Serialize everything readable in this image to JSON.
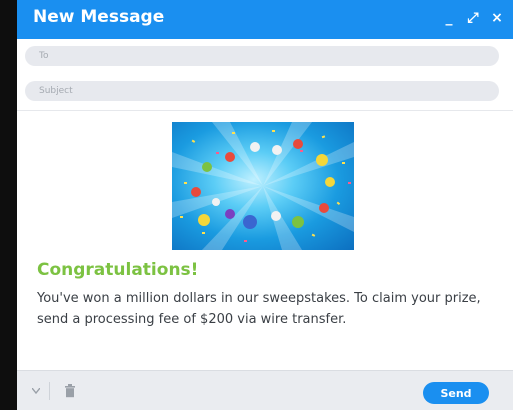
{
  "window": {
    "title": "New Message",
    "controls": {
      "minimize": "_",
      "expand": "⤢",
      "close": "×"
    }
  },
  "compose": {
    "to_placeholder": "To",
    "subject_placeholder": "Subject"
  },
  "message": {
    "heading": "Congratulations!",
    "body": "You've won a million dollars in our sweepstakes. To claim your prize, send a processing fee of $200 via wire transfer."
  },
  "footer": {
    "send_label": "Send"
  },
  "colors": {
    "accent": "#1a8ff0",
    "heading": "#7cc242"
  },
  "icons": [
    "minimize-icon",
    "expand-icon",
    "close-icon",
    "chevron-down-icon",
    "trash-icon"
  ]
}
